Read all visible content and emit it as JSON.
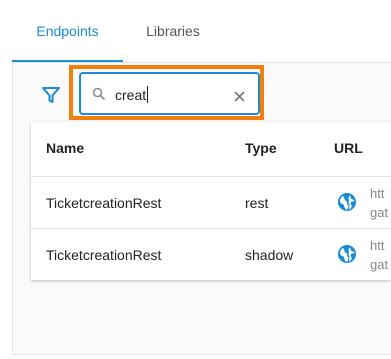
{
  "tabs": [
    {
      "label": "Endpoints",
      "active": true
    },
    {
      "label": "Libraries",
      "active": false
    }
  ],
  "search": {
    "value": "creat",
    "placeholder": ""
  },
  "table": {
    "headers": [
      "Name",
      "Type",
      "URL"
    ],
    "rows": [
      {
        "name": "TicketcreationRest",
        "type": "rest",
        "url_line1": "htt",
        "url_line2": "gat"
      },
      {
        "name": "TicketcreationRest",
        "type": "shadow",
        "url_line1": "htt",
        "url_line2": "gat"
      }
    ]
  },
  "colors": {
    "accent": "#1b8bd4",
    "highlight": "#f07f0c"
  }
}
